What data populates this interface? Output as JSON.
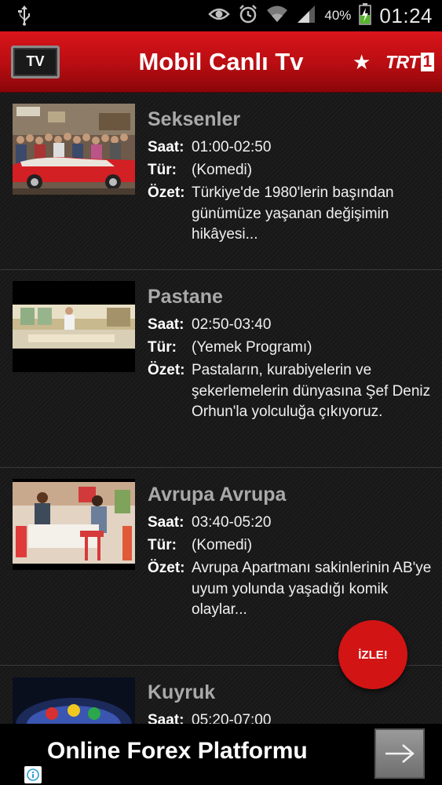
{
  "status_bar": {
    "battery_percent": "40%",
    "time": "01:24",
    "icons": [
      "usb-icon",
      "eye-icon",
      "alarm-icon",
      "wifi-icon",
      "signal-icon",
      "battery-icon"
    ]
  },
  "header": {
    "title": "Mobil Canlı Tv",
    "tv_logo_text": "TV",
    "channel_logo_text": "TRT",
    "channel_logo_number": "1",
    "accent_color": "#c40d12"
  },
  "programs": [
    {
      "title": "Seksenler",
      "time_label": "Saat:",
      "time": "01:00-02:50",
      "genre_label": "Tür:",
      "genre": "(Komedi)",
      "summary_label": "Özet:",
      "summary": "Türkiye'de 1980'lerin başından günümüze yaşanan değişimin hikâyesi..."
    },
    {
      "title": "Pastane",
      "time_label": "Saat:",
      "time": "02:50-03:40",
      "genre_label": "Tür:",
      "genre": "(Yemek Programı)",
      "summary_label": "Özet:",
      "summary": "Pastaların, kurabiyelerin ve şekerlemelerin dünyasına Şef Deniz Orhun'la yolculuğa çıkıyoruz."
    },
    {
      "title": "Avrupa Avrupa",
      "time_label": "Saat:",
      "time": "03:40-05:20",
      "genre_label": "Tür:",
      "genre": "(Komedi)",
      "summary_label": "Özet:",
      "summary": "Avrupa Apartmanı sakinlerinin AB'ye uyum yolunda yaşadığı komik olaylar..."
    },
    {
      "title": "Kuyruk",
      "time_label": "Saat:",
      "time": "05:20-07:00"
    }
  ],
  "fab": {
    "label": "İZLE!"
  },
  "ad": {
    "text": "Online Forex Platformu"
  }
}
